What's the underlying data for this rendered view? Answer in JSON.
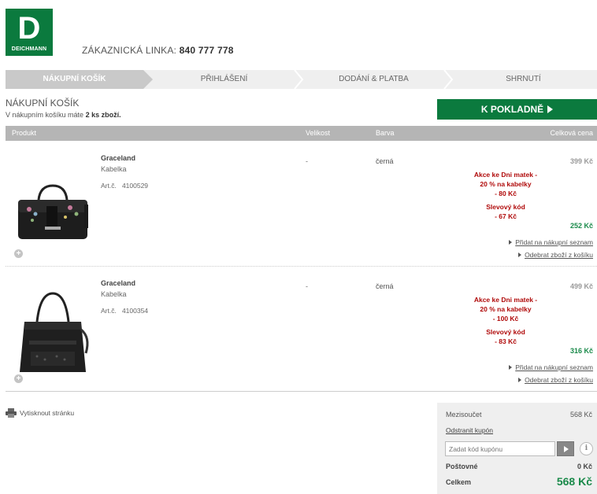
{
  "brand": {
    "logo_letter": "D",
    "logo_text": "DEICHMANN",
    "color": "#0b7a3e"
  },
  "header": {
    "hotline_label": "ZÁKAZNICKÁ LINKA:",
    "hotline_number": "840 777 778"
  },
  "steps": [
    {
      "label": "NÁKUPNÍ KOŠÍK",
      "active": true
    },
    {
      "label": "PŘIHLÁŠENÍ",
      "active": false
    },
    {
      "label": "DODÁNÍ & PLATBA",
      "active": false
    },
    {
      "label": "SHRNUTÍ",
      "active": false
    }
  ],
  "cart": {
    "title": "NÁKUPNÍ KOŠÍK",
    "sub_prefix": "V nákupním košíku máte",
    "sub_count": "2 ks zboží.",
    "checkout_label": "K POKLADNĚ"
  },
  "table": {
    "columns": {
      "product": "Produkt",
      "size": "Velikost",
      "color": "Barva",
      "total": "Celková cena"
    },
    "rows": [
      {
        "name": "Graceland",
        "type": "Kabelka",
        "art_label": "Art.č.",
        "art_no": "4100529",
        "size": "-",
        "color": "černá",
        "orig_price": "399 Kč",
        "discount1": [
          "Akce ke Dni matek -",
          "20 % na kabelky",
          "- 80 Kč"
        ],
        "discount2": [
          "Slevový kód",
          "- 67 Kč"
        ],
        "final_price": "252 Kč",
        "link_wishlist": "Přidat na nákupní seznam",
        "link_remove": "Odebrat zboží z košíku"
      },
      {
        "name": "Graceland",
        "type": "Kabelka",
        "art_label": "Art.č.",
        "art_no": "4100354",
        "size": "-",
        "color": "černá",
        "orig_price": "499 Kč",
        "discount1": [
          "Akce ke Dni matek -",
          "20 % na kabelky",
          "- 100 Kč"
        ],
        "discount2": [
          "Slevový kód",
          "- 83 Kč"
        ],
        "final_price": "316 Kč",
        "link_wishlist": "Přidat na nákupní seznam",
        "link_remove": "Odebrat zboží z košíku"
      }
    ]
  },
  "print_label": "Vytisknout stránku",
  "summary": {
    "subtotal_label": "Mezisoučet",
    "subtotal_value": "568 Kč",
    "remove_coupon": "Odstranit kupón",
    "coupon_placeholder": "Zadat kód kupónu",
    "shipping_label": "Poštovné",
    "shipping_value": "0 Kč",
    "total_label": "Celkem",
    "total_value": "568 Kč"
  }
}
